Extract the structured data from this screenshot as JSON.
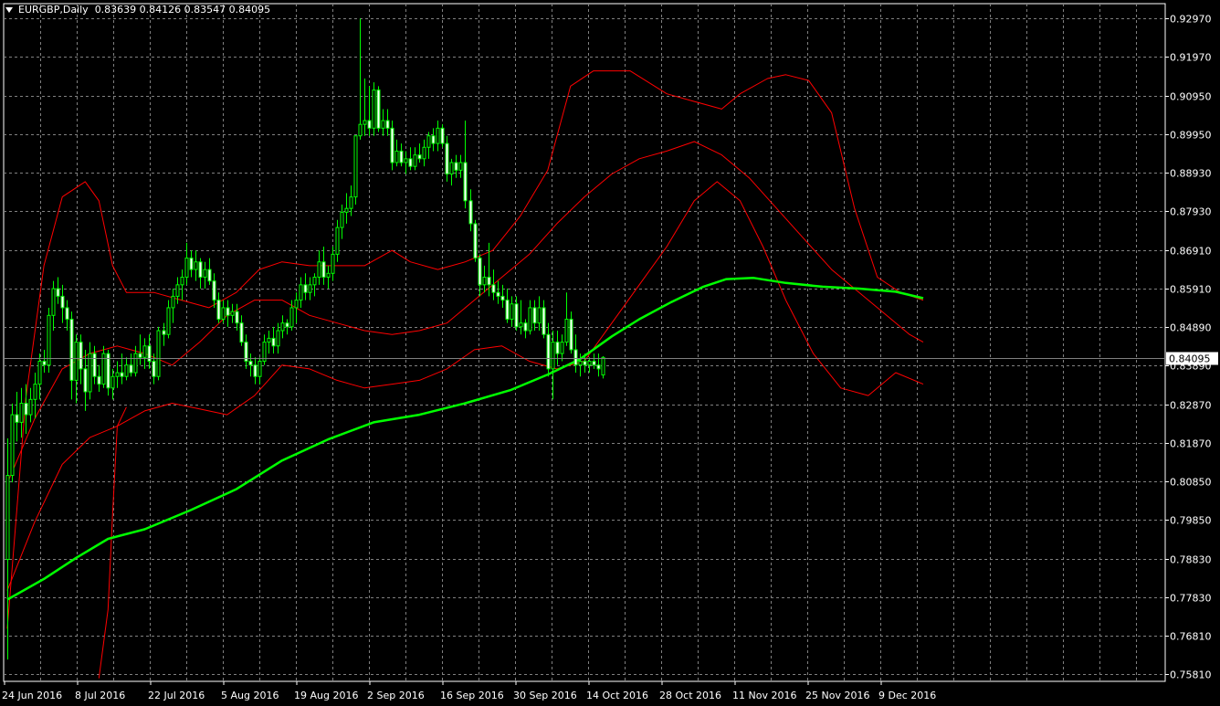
{
  "header": {
    "symbol": "EURGBP,Daily",
    "ohlc": "0.83639 0.84126 0.83547 0.84095"
  },
  "colors": {
    "background": "#000000",
    "grid": "#808080",
    "axis_text": "#ffffff",
    "candle": "#00ff00",
    "bull_body": "#000000",
    "bear_body": "#ffffff",
    "bollinger": "#ff0000",
    "moving_average": "#00ff00",
    "current_price_line": "#808080"
  },
  "chart_data": {
    "type": "candlestick",
    "symbol": "EURGBP",
    "timeframe": "Daily",
    "ylim": [
      0.7562,
      0.9336
    ],
    "grid": true,
    "y_ticks": [
      "0.92970",
      "0.91970",
      "0.90950",
      "0.89950",
      "0.88930",
      "0.87930",
      "0.86910",
      "0.85910",
      "0.84890",
      "0.83890",
      "0.82870",
      "0.81870",
      "0.80850",
      "0.79850",
      "0.78830",
      "0.77830",
      "0.76810",
      "0.75810"
    ],
    "x_ticks": [
      "24 Jun 2016",
      "8 Jul 2016",
      "22 Jul 2016",
      "5 Aug 2016",
      "19 Aug 2016",
      "2 Sep 2016",
      "16 Sep 2016",
      "30 Sep 2016",
      "14 Oct 2016",
      "28 Oct 2016",
      "11 Nov 2016",
      "25 Nov 2016",
      "9 Dec 2016"
    ],
    "current_price": "0.84095",
    "candles": [
      [
        0.7881,
        0.8198,
        0.7619,
        0.8101
      ],
      [
        0.8101,
        0.8289,
        0.8083,
        0.826
      ],
      [
        0.826,
        0.832,
        0.819,
        0.824
      ],
      [
        0.824,
        0.833,
        0.82,
        0.829
      ],
      [
        0.829,
        0.834,
        0.821,
        0.826
      ],
      [
        0.826,
        0.833,
        0.824,
        0.83
      ],
      [
        0.83,
        0.837,
        0.825,
        0.834
      ],
      [
        0.834,
        0.842,
        0.83,
        0.84
      ],
      [
        0.84,
        0.843,
        0.837,
        0.839
      ],
      [
        0.839,
        0.854,
        0.837,
        0.852
      ],
      [
        0.852,
        0.861,
        0.848,
        0.859
      ],
      [
        0.859,
        0.862,
        0.855,
        0.857
      ],
      [
        0.857,
        0.86,
        0.85,
        0.854
      ],
      [
        0.854,
        0.856,
        0.848,
        0.851
      ],
      [
        0.851,
        0.853,
        0.83,
        0.835
      ],
      [
        0.835,
        0.847,
        0.829,
        0.845
      ],
      [
        0.845,
        0.847,
        0.834,
        0.838
      ],
      [
        0.838,
        0.843,
        0.827,
        0.832
      ],
      [
        0.832,
        0.845,
        0.83,
        0.842
      ],
      [
        0.842,
        0.844,
        0.834,
        0.836
      ],
      [
        0.836,
        0.839,
        0.832,
        0.834
      ],
      [
        0.834,
        0.844,
        0.833,
        0.842
      ],
      [
        0.842,
        0.843,
        0.831,
        0.833
      ],
      [
        0.833,
        0.838,
        0.83,
        0.836
      ],
      [
        0.836,
        0.84,
        0.833,
        0.837
      ],
      [
        0.837,
        0.842,
        0.834,
        0.836
      ],
      [
        0.836,
        0.841,
        0.835,
        0.839
      ],
      [
        0.839,
        0.842,
        0.836,
        0.837
      ],
      [
        0.837,
        0.844,
        0.836,
        0.842
      ],
      [
        0.842,
        0.847,
        0.839,
        0.841
      ],
      [
        0.841,
        0.846,
        0.838,
        0.844
      ],
      [
        0.844,
        0.847,
        0.838,
        0.84
      ],
      [
        0.84,
        0.842,
        0.834,
        0.836
      ],
      [
        0.836,
        0.849,
        0.835,
        0.848
      ],
      [
        0.848,
        0.85,
        0.844,
        0.847
      ],
      [
        0.847,
        0.856,
        0.846,
        0.854
      ],
      [
        0.854,
        0.859,
        0.85,
        0.857
      ],
      [
        0.857,
        0.862,
        0.855,
        0.86
      ],
      [
        0.86,
        0.864,
        0.856,
        0.862
      ],
      [
        0.862,
        0.871,
        0.86,
        0.867
      ],
      [
        0.867,
        0.869,
        0.862,
        0.864
      ],
      [
        0.864,
        0.869,
        0.861,
        0.866
      ],
      [
        0.866,
        0.867,
        0.859,
        0.862
      ],
      [
        0.862,
        0.866,
        0.859,
        0.864
      ],
      [
        0.864,
        0.867,
        0.86,
        0.861
      ],
      [
        0.861,
        0.863,
        0.854,
        0.856
      ],
      [
        0.856,
        0.858,
        0.85,
        0.851
      ],
      [
        0.851,
        0.856,
        0.85,
        0.854
      ],
      [
        0.854,
        0.856,
        0.849,
        0.852
      ],
      [
        0.852,
        0.855,
        0.85,
        0.853
      ],
      [
        0.853,
        0.855,
        0.848,
        0.85
      ],
      [
        0.85,
        0.852,
        0.844,
        0.845
      ],
      [
        0.845,
        0.847,
        0.838,
        0.84
      ],
      [
        0.84,
        0.842,
        0.836,
        0.839
      ],
      [
        0.839,
        0.841,
        0.834,
        0.836
      ],
      [
        0.836,
        0.841,
        0.834,
        0.84
      ],
      [
        0.84,
        0.847,
        0.839,
        0.845
      ],
      [
        0.845,
        0.848,
        0.842,
        0.846
      ],
      [
        0.846,
        0.849,
        0.842,
        0.844
      ],
      [
        0.844,
        0.85,
        0.842,
        0.848
      ],
      [
        0.848,
        0.852,
        0.846,
        0.85
      ],
      [
        0.85,
        0.851,
        0.847,
        0.849
      ],
      [
        0.849,
        0.856,
        0.848,
        0.854
      ],
      [
        0.854,
        0.858,
        0.85,
        0.856
      ],
      [
        0.856,
        0.862,
        0.854,
        0.86
      ],
      [
        0.86,
        0.863,
        0.856,
        0.858
      ],
      [
        0.858,
        0.862,
        0.856,
        0.86
      ],
      [
        0.86,
        0.863,
        0.857,
        0.862
      ],
      [
        0.862,
        0.869,
        0.86,
        0.866
      ],
      [
        0.866,
        0.87,
        0.86,
        0.862
      ],
      [
        0.862,
        0.865,
        0.859,
        0.863
      ],
      [
        0.863,
        0.87,
        0.861,
        0.868
      ],
      [
        0.868,
        0.877,
        0.866,
        0.875
      ],
      [
        0.875,
        0.881,
        0.872,
        0.879
      ],
      [
        0.879,
        0.884,
        0.876,
        0.88
      ],
      [
        0.88,
        0.886,
        0.878,
        0.883
      ],
      [
        0.883,
        0.896,
        0.881,
        0.899
      ],
      [
        0.899,
        0.9297,
        0.898,
        0.902
      ],
      [
        0.902,
        0.914,
        0.899,
        0.903
      ],
      [
        0.903,
        0.912,
        0.899,
        0.901
      ],
      [
        0.901,
        0.913,
        0.899,
        0.911
      ],
      [
        0.911,
        0.912,
        0.9,
        0.901
      ],
      [
        0.901,
        0.906,
        0.899,
        0.903
      ],
      [
        0.903,
        0.906,
        0.899,
        0.901
      ],
      [
        0.901,
        0.903,
        0.89,
        0.892
      ],
      [
        0.892,
        0.898,
        0.891,
        0.895
      ],
      [
        0.895,
        0.897,
        0.891,
        0.892
      ],
      [
        0.892,
        0.895,
        0.889,
        0.893
      ],
      [
        0.893,
        0.896,
        0.89,
        0.891
      ],
      [
        0.891,
        0.896,
        0.89,
        0.894
      ],
      [
        0.894,
        0.897,
        0.892,
        0.893
      ],
      [
        0.893,
        0.898,
        0.891,
        0.896
      ],
      [
        0.896,
        0.9,
        0.893,
        0.899
      ],
      [
        0.899,
        0.901,
        0.895,
        0.897
      ],
      [
        0.897,
        0.903,
        0.895,
        0.901
      ],
      [
        0.901,
        0.902,
        0.896,
        0.897
      ],
      [
        0.897,
        0.899,
        0.887,
        0.889
      ],
      [
        0.889,
        0.893,
        0.886,
        0.892
      ],
      [
        0.892,
        0.894,
        0.888,
        0.89
      ],
      [
        0.89,
        0.894,
        0.888,
        0.892
      ],
      [
        0.892,
        0.903,
        0.88,
        0.882
      ],
      [
        0.882,
        0.885,
        0.874,
        0.876
      ],
      [
        0.876,
        0.877,
        0.866,
        0.867
      ],
      [
        0.867,
        0.868,
        0.857,
        0.86
      ],
      [
        0.86,
        0.865,
        0.858,
        0.862
      ],
      [
        0.862,
        0.871,
        0.857,
        0.86
      ],
      [
        0.86,
        0.864,
        0.856,
        0.858
      ],
      [
        0.858,
        0.861,
        0.855,
        0.857
      ],
      [
        0.857,
        0.86,
        0.854,
        0.856
      ],
      [
        0.856,
        0.859,
        0.85,
        0.851
      ],
      [
        0.851,
        0.857,
        0.849,
        0.855
      ],
      [
        0.855,
        0.857,
        0.848,
        0.849
      ],
      [
        0.849,
        0.856,
        0.847,
        0.85
      ],
      [
        0.85,
        0.851,
        0.846,
        0.848
      ],
      [
        0.848,
        0.856,
        0.847,
        0.854
      ],
      [
        0.854,
        0.856,
        0.848,
        0.85
      ],
      [
        0.85,
        0.857,
        0.848,
        0.854
      ],
      [
        0.854,
        0.856,
        0.846,
        0.847
      ],
      [
        0.847,
        0.85,
        0.836,
        0.838
      ],
      [
        0.838,
        0.848,
        0.83,
        0.845
      ],
      [
        0.845,
        0.848,
        0.839,
        0.842
      ],
      [
        0.842,
        0.847,
        0.84,
        0.845
      ],
      [
        0.845,
        0.858,
        0.844,
        0.851
      ],
      [
        0.851,
        0.853,
        0.842,
        0.843
      ],
      [
        0.843,
        0.847,
        0.837,
        0.839
      ],
      [
        0.839,
        0.842,
        0.836,
        0.84
      ],
      [
        0.84,
        0.842,
        0.837,
        0.839
      ],
      [
        0.839,
        0.841,
        0.837,
        0.84
      ],
      [
        0.84,
        0.842,
        0.838,
        0.839
      ],
      [
        0.839,
        0.842,
        0.836,
        0.838
      ],
      [
        0.8364,
        0.8413,
        0.8355,
        0.841
      ]
    ],
    "moving_average": [
      [
        0,
        0.7776
      ],
      [
        8,
        0.783
      ],
      [
        15,
        0.7885
      ],
      [
        22,
        0.7935
      ],
      [
        30,
        0.796
      ],
      [
        40,
        0.801
      ],
      [
        50,
        0.8065
      ],
      [
        60,
        0.814
      ],
      [
        70,
        0.8195
      ],
      [
        80,
        0.824
      ],
      [
        90,
        0.826
      ],
      [
        100,
        0.829
      ],
      [
        110,
        0.8325
      ],
      [
        118,
        0.8365
      ],
      [
        125,
        0.8405
      ],
      [
        132,
        0.8465
      ],
      [
        138,
        0.851
      ],
      [
        145,
        0.8555
      ],
      [
        152,
        0.8595
      ],
      [
        157,
        0.8615
      ],
      [
        163,
        0.8618
      ],
      [
        170,
        0.8605
      ],
      [
        178,
        0.8595
      ],
      [
        186,
        0.859
      ],
      [
        194,
        0.8582
      ],
      [
        200,
        0.8565
      ]
    ],
    "bollinger_upper": [
      [
        0,
        0.77
      ],
      [
        4,
        0.83
      ],
      [
        8,
        0.865
      ],
      [
        12,
        0.883
      ],
      [
        17,
        0.887
      ],
      [
        20,
        0.882
      ],
      [
        23,
        0.865
      ],
      [
        26,
        0.858
      ],
      [
        32,
        0.858
      ],
      [
        38,
        0.856
      ],
      [
        44,
        0.854
      ],
      [
        50,
        0.858
      ],
      [
        55,
        0.864
      ],
      [
        60,
        0.866
      ],
      [
        66,
        0.865
      ],
      [
        72,
        0.865
      ],
      [
        78,
        0.865
      ],
      [
        84,
        0.869
      ],
      [
        88,
        0.866
      ],
      [
        94,
        0.864
      ],
      [
        100,
        0.866
      ],
      [
        106,
        0.869
      ],
      [
        112,
        0.878
      ],
      [
        118,
        0.89
      ],
      [
        123,
        0.912
      ],
      [
        128,
        0.916
      ],
      [
        136,
        0.916
      ],
      [
        144,
        0.91
      ],
      [
        150,
        0.908
      ],
      [
        156,
        0.906
      ],
      [
        160,
        0.91
      ],
      [
        166,
        0.914
      ],
      [
        170,
        0.915
      ],
      [
        175,
        0.9135
      ],
      [
        180,
        0.905
      ],
      [
        185,
        0.88
      ],
      [
        190,
        0.862
      ],
      [
        195,
        0.858
      ],
      [
        200,
        0.856
      ]
    ],
    "bollinger_middle": [
      [
        0,
        0.808
      ],
      [
        6,
        0.825
      ],
      [
        12,
        0.838
      ],
      [
        18,
        0.842
      ],
      [
        24,
        0.844
      ],
      [
        30,
        0.842
      ],
      [
        36,
        0.839
      ],
      [
        42,
        0.845
      ],
      [
        48,
        0.852
      ],
      [
        54,
        0.856
      ],
      [
        60,
        0.856
      ],
      [
        66,
        0.852
      ],
      [
        72,
        0.85
      ],
      [
        78,
        0.848
      ],
      [
        84,
        0.847
      ],
      [
        90,
        0.848
      ],
      [
        96,
        0.85
      ],
      [
        102,
        0.856
      ],
      [
        108,
        0.862
      ],
      [
        114,
        0.868
      ],
      [
        120,
        0.876
      ],
      [
        126,
        0.883
      ],
      [
        132,
        0.889
      ],
      [
        138,
        0.893
      ],
      [
        144,
        0.895
      ],
      [
        150,
        0.8975
      ],
      [
        156,
        0.894
      ],
      [
        162,
        0.888
      ],
      [
        168,
        0.88
      ],
      [
        174,
        0.872
      ],
      [
        180,
        0.864
      ],
      [
        186,
        0.858
      ],
      [
        192,
        0.852
      ],
      [
        197,
        0.847
      ],
      [
        200,
        0.845
      ]
    ],
    "bollinger_lower": [
      [
        0,
        0.78
      ],
      [
        6,
        0.798
      ],
      [
        12,
        0.813
      ],
      [
        18,
        0.82
      ],
      [
        24,
        0.823
      ],
      [
        30,
        0.827
      ],
      [
        36,
        0.829
      ],
      [
        42,
        0.8275
      ],
      [
        48,
        0.826
      ],
      [
        54,
        0.831
      ],
      [
        60,
        0.839
      ],
      [
        66,
        0.838
      ],
      [
        72,
        0.835
      ],
      [
        78,
        0.833
      ],
      [
        84,
        0.834
      ],
      [
        90,
        0.835
      ],
      [
        96,
        0.838
      ],
      [
        102,
        0.843
      ],
      [
        108,
        0.844
      ],
      [
        114,
        0.84
      ],
      [
        120,
        0.838
      ],
      [
        126,
        0.84
      ],
      [
        132,
        0.85
      ],
      [
        138,
        0.86
      ],
      [
        144,
        0.87
      ],
      [
        150,
        0.882
      ],
      [
        155,
        0.887
      ],
      [
        160,
        0.882
      ],
      [
        165,
        0.87
      ],
      [
        170,
        0.856
      ],
      [
        176,
        0.842
      ],
      [
        182,
        0.833
      ],
      [
        188,
        0.831
      ],
      [
        194,
        0.837
      ],
      [
        200,
        0.834
      ]
    ],
    "bollinger_extra_lower": [
      [
        20,
        0.757
      ],
      [
        22,
        0.775
      ],
      [
        23,
        0.8
      ],
      [
        24,
        0.823
      ],
      [
        26,
        0.828
      ]
    ]
  }
}
